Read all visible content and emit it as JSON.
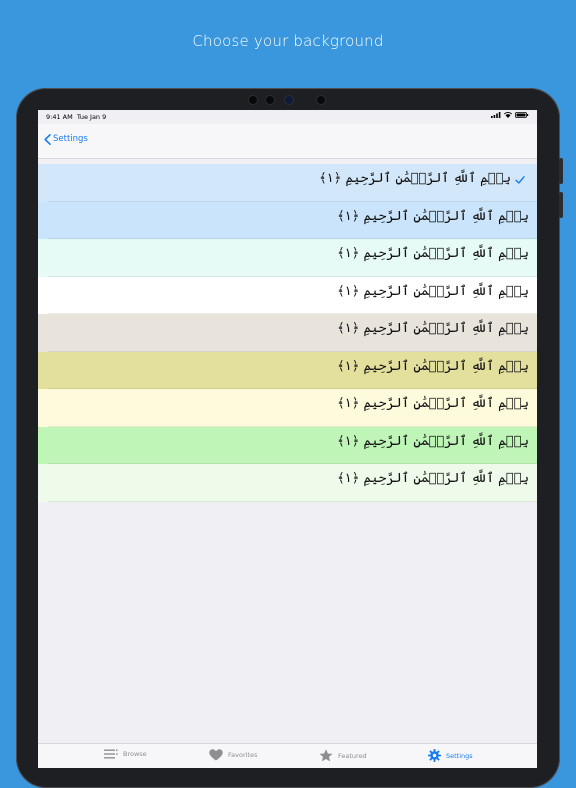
{
  "headline": "Choose your background",
  "status_bar": {
    "time": "9:41 AM",
    "date": "Tue Jan 9"
  },
  "nav": {
    "back_label": "Settings",
    "back_icon": "chevron-left-icon"
  },
  "options": [
    {
      "verse": "بِسۡمِ ٱللَّهِ ٱلرَّحۡمَٰنِ ٱلرَّحِيمِ ﴿١﴾",
      "bg": "#d2e8fa",
      "selected": true
    },
    {
      "verse": "بِسۡمِ ٱللَّهِ ٱلرَّحۡمَٰنِ ٱلرَّحِيمِ ﴿١﴾",
      "bg": "#c9e4fb",
      "selected": false
    },
    {
      "verse": "بِسۡمِ ٱللَّهِ ٱلرَّحۡمَٰنِ ٱلرَّحِيمِ ﴿١﴾",
      "bg": "#e6fbf6",
      "selected": false
    },
    {
      "verse": "بِسۡمِ ٱللَّهِ ٱلرَّحۡمَٰنِ ٱلرَّحِيمِ ﴿١﴾",
      "bg": "#ffffff",
      "selected": false
    },
    {
      "verse": "بِسۡمِ ٱللَّهِ ٱلرَّحۡمَٰنِ ٱلرَّحِيمِ ﴿١﴾",
      "bg": "#e8e4dc",
      "selected": false
    },
    {
      "verse": "بِسۡمِ ٱللَّهِ ٱلرَّحۡمَٰنِ ٱلرَّحِيمِ ﴿١﴾",
      "bg": "#e3df9c",
      "selected": false
    },
    {
      "verse": "بِسۡمِ ٱللَّهِ ٱلرَّحۡمَٰنِ ٱلرَّحِيمِ ﴿١﴾",
      "bg": "#fefbdd",
      "selected": false
    },
    {
      "verse": "بِسۡمِ ٱللَّهِ ٱلرَّحۡمَٰنِ ٱلرَّحِيمِ ﴿١﴾",
      "bg": "#bff6b8",
      "selected": false
    },
    {
      "verse": "بِسۡمِ ٱللَّهِ ٱلرَّحۡمَٰنِ ٱلرَّحِيمِ ﴿١﴾",
      "bg": "#eefbea",
      "selected": false
    }
  ],
  "tabs": [
    {
      "label": "Browse",
      "icon": "list-icon",
      "active": false
    },
    {
      "label": "Favorites",
      "icon": "heart-icon",
      "active": false
    },
    {
      "label": "Featured",
      "icon": "star-icon",
      "active": false
    },
    {
      "label": "Settings",
      "icon": "gear-icon",
      "active": true
    }
  ],
  "colors": {
    "page_background": "#3a97dd",
    "accent": "#1a7cf2",
    "inactive_tab": "#8e8e93"
  }
}
